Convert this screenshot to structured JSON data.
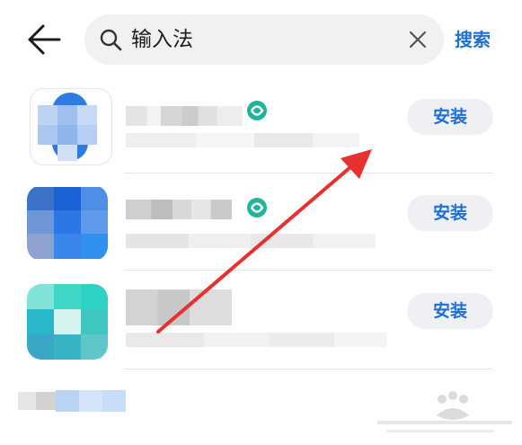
{
  "header": {
    "search_query": "输入法",
    "search_button": "搜索"
  },
  "results": [
    {
      "install_label": "安装"
    },
    {
      "install_label": "安装"
    },
    {
      "install_label": "安装"
    }
  ],
  "colors": {
    "accent": "#1f6fd8",
    "annotation_arrow": "#e8312f",
    "search_bg": "#f0f1f3",
    "button_bg": "#eef0f3"
  },
  "icons": [
    "back-arrow-icon",
    "search-icon",
    "clear-icon",
    "verified-badge-icon"
  ]
}
